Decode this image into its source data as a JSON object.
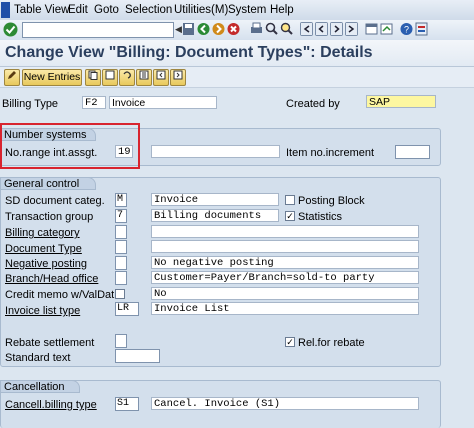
{
  "menu": [
    "Table View",
    "Edit",
    "Goto",
    "Selection",
    "Utilities(M)",
    "System",
    "Help"
  ],
  "page_title": "Change View \"Billing: Document Types\": Details",
  "toolbar2": {
    "new_entries": "New Entries"
  },
  "header": {
    "billing_type_label": "Billing Type",
    "billing_type_value": "F2",
    "billing_type_desc": "Invoice",
    "created_by_label": "Created by",
    "created_by_value": "SAP"
  },
  "number_systems": {
    "title": "Number systems",
    "no_range_label": "No.range int.assgt.",
    "no_range_value": "19",
    "item_increment_label": "Item no.increment",
    "item_increment_value": ""
  },
  "general_control": {
    "title": "General control",
    "sd_document_categ_label": "SD document categ.",
    "sd_document_categ_value": "M",
    "sd_document_categ_desc": "Invoice",
    "posting_block_label": "Posting Block",
    "transaction_group_label": "Transaction group",
    "transaction_group_value": "7",
    "transaction_group_desc": "Billing documents",
    "statistics_label": "Statistics",
    "billing_category_label": "Billing category",
    "document_type_label": "Document Type",
    "negative_posting_label": "Negative posting",
    "negative_posting_desc": "No negative posting",
    "branch_head_label": "Branch/Head office",
    "branch_head_desc": "Customer=Payer/Branch=sold-to party",
    "credit_memo_label": "Credit memo w/ValDat",
    "credit_memo_desc": "No",
    "invoice_list_type_label": "Invoice list type",
    "invoice_list_type_value": "LR",
    "invoice_list_type_desc": "Invoice List",
    "rebate_settlement_label": "Rebate settlement",
    "rel_for_rebate_label": "Rel.for rebate",
    "standard_text_label": "Standard text"
  },
  "cancellation": {
    "title": "Cancellation",
    "cancell_billing_type_label": "Cancell.billing type",
    "cancell_billing_type_value": "S1",
    "cancell_billing_type_desc": "Cancel. Invoice (S1)"
  },
  "checkboxes": {
    "posting_block": false,
    "statistics": true,
    "rel_for_rebate": true,
    "credit_memo": false
  },
  "colors": {
    "highlight_border": "#d8242f",
    "created_by_bg": "#fdf7a0"
  }
}
